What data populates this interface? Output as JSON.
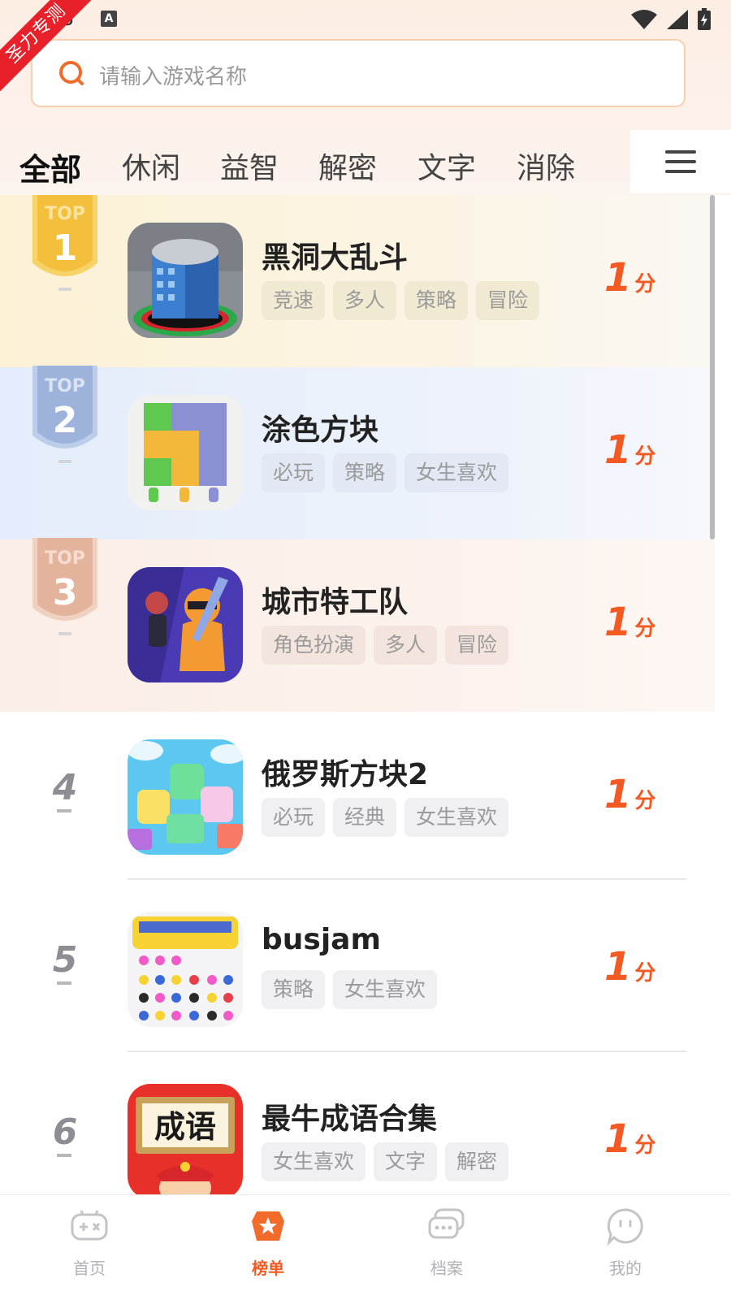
{
  "status_bar": {
    "time": "08",
    "a_label": "A"
  },
  "ribbon": {
    "text": "圣力专测"
  },
  "search": {
    "placeholder": "请输入游戏名称"
  },
  "tabs": [
    {
      "label": "全部",
      "active": true
    },
    {
      "label": "休闲"
    },
    {
      "label": "益智"
    },
    {
      "label": "解密"
    },
    {
      "label": "文字"
    },
    {
      "label": "消除"
    }
  ],
  "games": [
    {
      "rank": "1",
      "name": "黑洞大乱斗",
      "tags": [
        "竞速",
        "多人",
        "策略",
        "冒险"
      ],
      "score": "1",
      "score_unit": "分",
      "medal_label": "TOP"
    },
    {
      "rank": "2",
      "name": "涂色方块",
      "tags": [
        "必玩",
        "策略",
        "女生喜欢"
      ],
      "score": "1",
      "score_unit": "分",
      "medal_label": "TOP"
    },
    {
      "rank": "3",
      "name": "城市特工队",
      "tags": [
        "角色扮演",
        "多人",
        "冒险"
      ],
      "score": "1",
      "score_unit": "分",
      "medal_label": "TOP"
    },
    {
      "rank": "4",
      "name": "俄罗斯方块2",
      "tags": [
        "必玩",
        "经典",
        "女生喜欢"
      ],
      "score": "1",
      "score_unit": "分"
    },
    {
      "rank": "5",
      "name": "busjam",
      "tags": [
        "策略",
        "女生喜欢"
      ],
      "score": "1",
      "score_unit": "分"
    },
    {
      "rank": "6",
      "name": "最牛成语合集",
      "tags": [
        "女生喜欢",
        "文字",
        "解密"
      ],
      "score": "1",
      "score_unit": "分",
      "icon_text": "成语"
    }
  ],
  "bottom_nav": [
    {
      "label": "首页",
      "icon": "gamepad-icon"
    },
    {
      "label": "榜单",
      "icon": "ranking-star-icon",
      "active": true
    },
    {
      "label": "档案",
      "icon": "chat-bubbles-icon"
    },
    {
      "label": "我的",
      "icon": "smile-bubble-icon"
    }
  ],
  "colors": {
    "accent": "#f25a24",
    "gold": "#f5c44a",
    "silver": "#9db3dc",
    "bronze": "#e3b49b",
    "ribbon": "#e8202a"
  }
}
